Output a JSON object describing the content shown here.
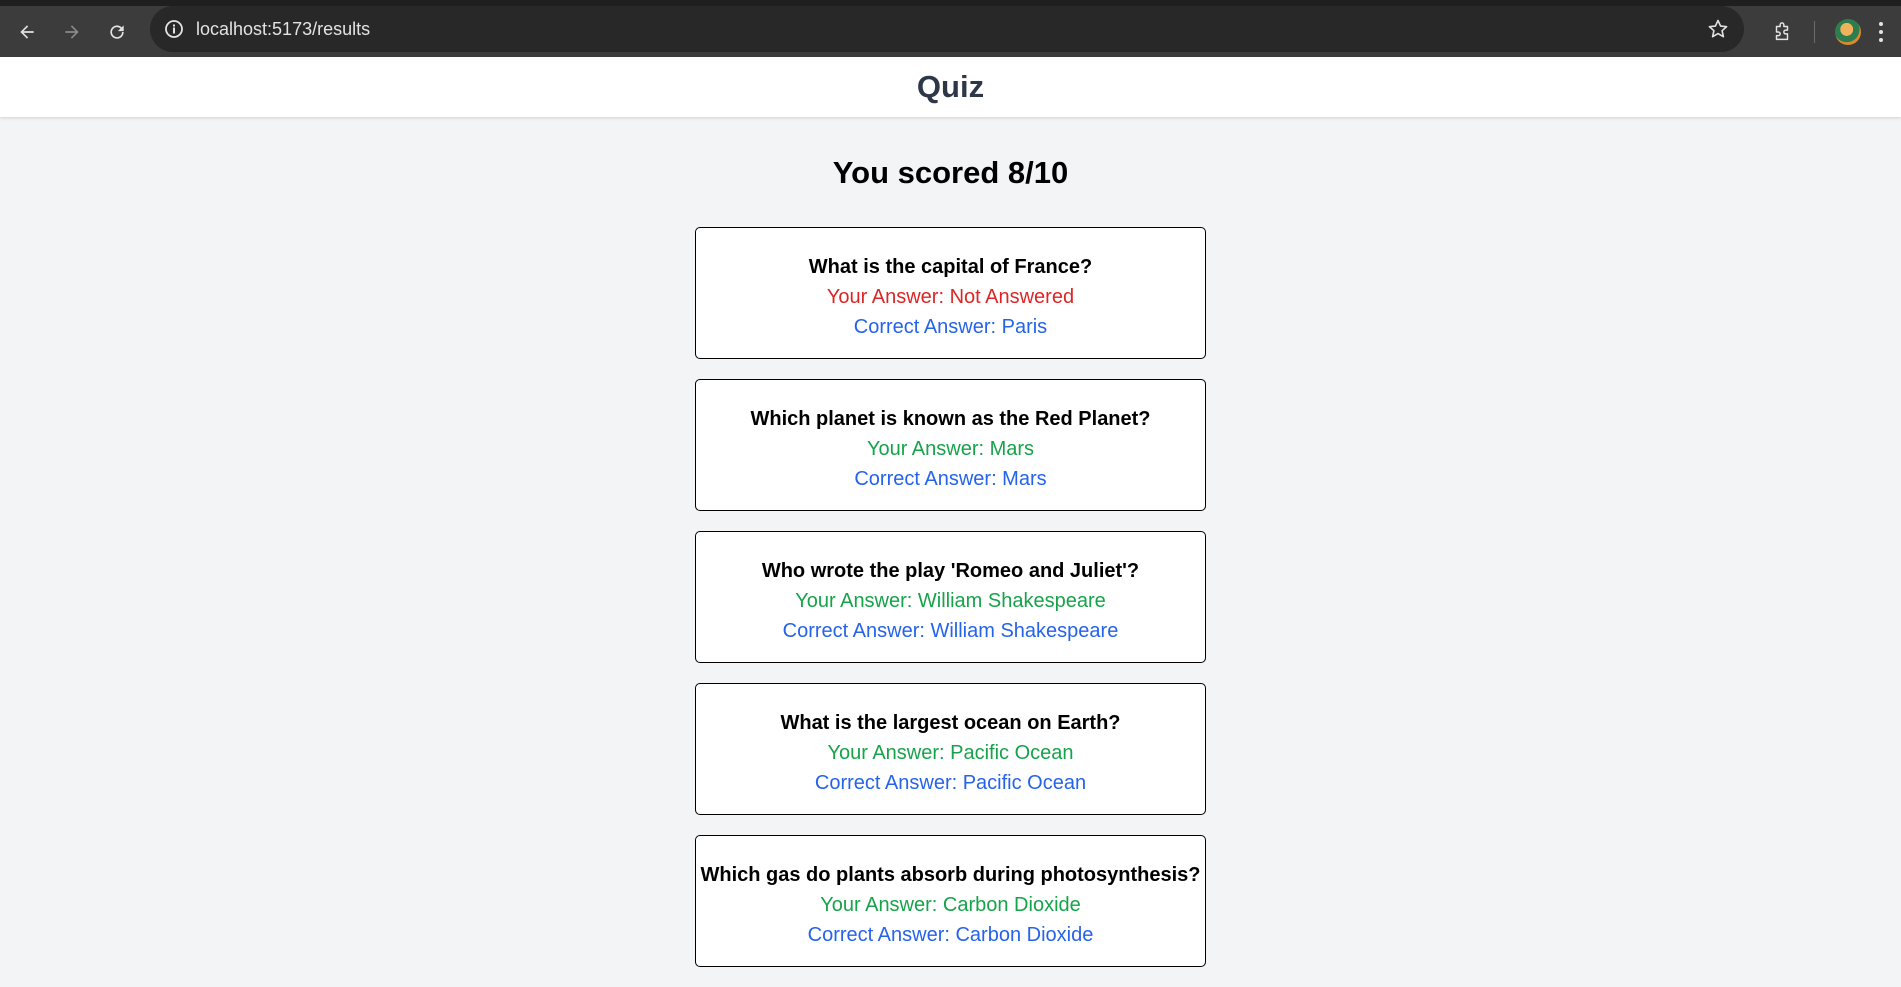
{
  "browser": {
    "url": "localhost:5173/results"
  },
  "app": {
    "title": "Quiz"
  },
  "results": {
    "score_text": "You scored 8/10",
    "items": [
      {
        "question": "What is the capital of France?",
        "your_answer": "Your Answer: Not Answered",
        "correct_answer": "Correct Answer: Paris",
        "status": "wrong"
      },
      {
        "question": "Which planet is known as the Red Planet?",
        "your_answer": "Your Answer: Mars",
        "correct_answer": "Correct Answer: Mars",
        "status": "right"
      },
      {
        "question": "Who wrote the play 'Romeo and Juliet'?",
        "your_answer": "Your Answer: William Shakespeare",
        "correct_answer": "Correct Answer: William Shakespeare",
        "status": "right"
      },
      {
        "question": "What is the largest ocean on Earth?",
        "your_answer": "Your Answer: Pacific Ocean",
        "correct_answer": "Correct Answer: Pacific Ocean",
        "status": "right"
      },
      {
        "question": "Which gas do plants absorb during photosynthesis?",
        "your_answer": "Your Answer: Carbon Dioxide",
        "correct_answer": "Correct Answer: Carbon Dioxide",
        "status": "right"
      }
    ]
  },
  "colors": {
    "wrong": "#dc2626",
    "right": "#16a34a",
    "correct": "#2563eb"
  },
  "icons": [
    "back-arrow-icon",
    "forward-arrow-icon",
    "reload-icon",
    "site-info-icon",
    "bookmark-star-icon",
    "extensions-icon",
    "profile-avatar",
    "more-menu-icon"
  ]
}
